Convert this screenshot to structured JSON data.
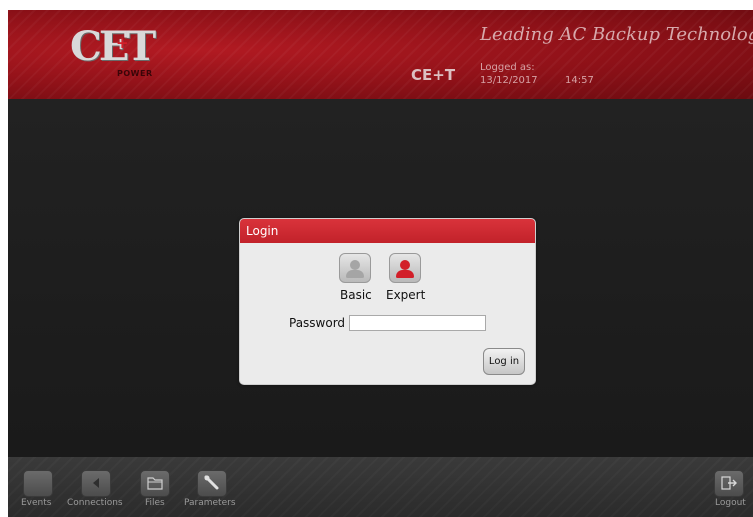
{
  "header": {
    "logo_text": "CET",
    "logo_plus": "+",
    "logo_sub": "POWER",
    "tagline": "Leading AC Backup Technology",
    "product": "CE+T",
    "logged_as_label": "Logged as:",
    "date": "13/12/2017",
    "time": "14:57"
  },
  "dialog": {
    "title": "Login",
    "roles": [
      {
        "label": "Basic",
        "icon": "user-icon-grey"
      },
      {
        "label": "Expert",
        "icon": "user-icon-red"
      }
    ],
    "password_label": "Password",
    "password_value": "",
    "login_button": "Log in"
  },
  "toolbar": {
    "items": [
      {
        "label": "Events",
        "icon": "events-icon"
      },
      {
        "label": "Connections",
        "icon": "connections-icon"
      },
      {
        "label": "Files",
        "icon": "folder-icon"
      },
      {
        "label": "Parameters",
        "icon": "wrench-icon"
      },
      {
        "label": "Logout",
        "icon": "logout-icon"
      }
    ]
  },
  "colors": {
    "brand_red": "#c2222a",
    "background": "#1c1c1c"
  }
}
